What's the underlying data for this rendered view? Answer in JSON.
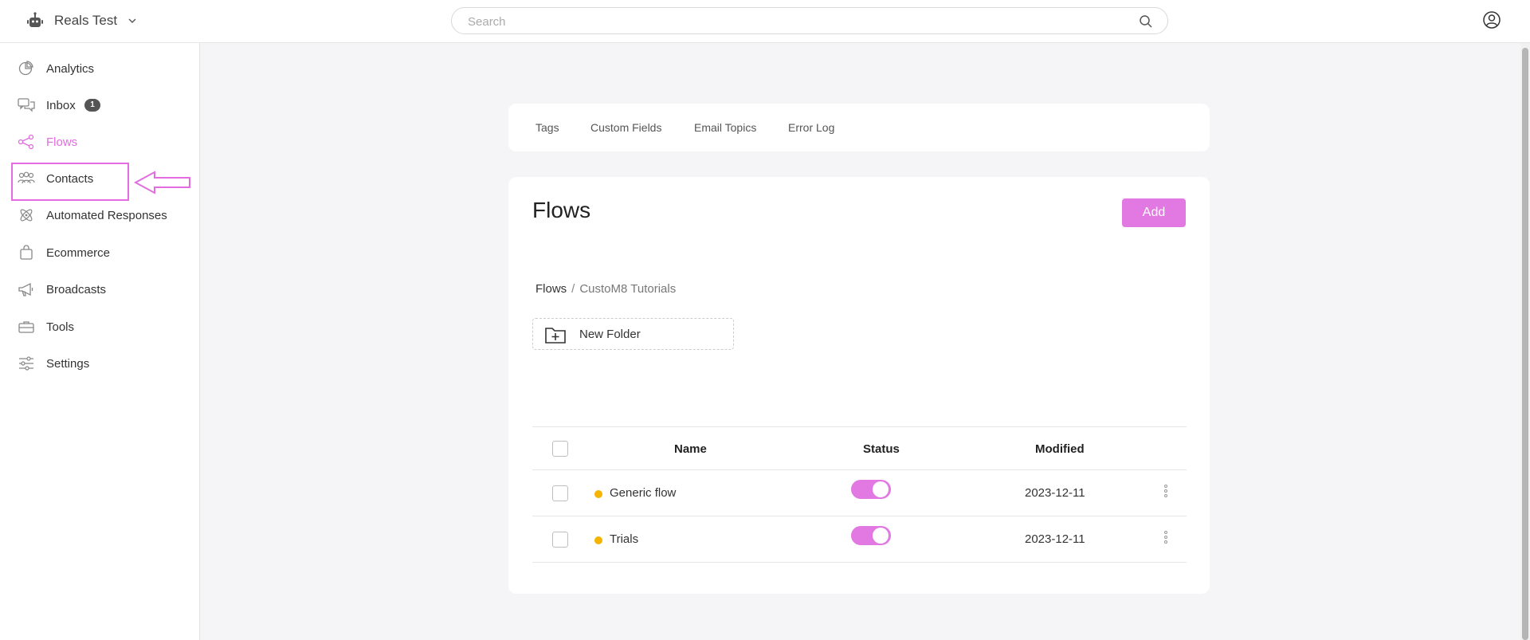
{
  "header": {
    "workspace_name": "Reals Test",
    "search_placeholder": "Search"
  },
  "sidebar": {
    "items": [
      {
        "label": "Analytics",
        "icon": "analytics-icon"
      },
      {
        "label": "Inbox",
        "icon": "inbox-icon",
        "badge": "1"
      },
      {
        "label": "Flows",
        "icon": "flows-icon",
        "active": true
      },
      {
        "label": "Contacts",
        "icon": "contacts-icon"
      },
      {
        "label": "Automated Responses",
        "icon": "automated-responses-icon"
      },
      {
        "label": "Ecommerce",
        "icon": "ecommerce-icon"
      },
      {
        "label": "Broadcasts",
        "icon": "broadcasts-icon"
      },
      {
        "label": "Tools",
        "icon": "tools-icon"
      },
      {
        "label": "Settings",
        "icon": "settings-icon"
      }
    ]
  },
  "tabs": [
    "Tags",
    "Custom Fields",
    "Email Topics",
    "Error Log"
  ],
  "page": {
    "title": "Flows",
    "add_label": "Add",
    "breadcrumb": {
      "root": "Flows",
      "separator": "/",
      "current": "CustoM8 Tutorials"
    },
    "new_folder_label": "New Folder"
  },
  "table": {
    "columns": [
      "Name",
      "Status",
      "Modified"
    ],
    "rows": [
      {
        "name": "Generic flow",
        "status": "on",
        "modified": "2023-12-11",
        "status_color": "#f5b400"
      },
      {
        "name": "Trials",
        "status": "on",
        "modified": "2023-12-11",
        "status_color": "#f5b400"
      }
    ]
  },
  "colors": {
    "accent": "#e278e2",
    "active_nav": "#e26ce0",
    "status_dot": "#f5b400"
  }
}
